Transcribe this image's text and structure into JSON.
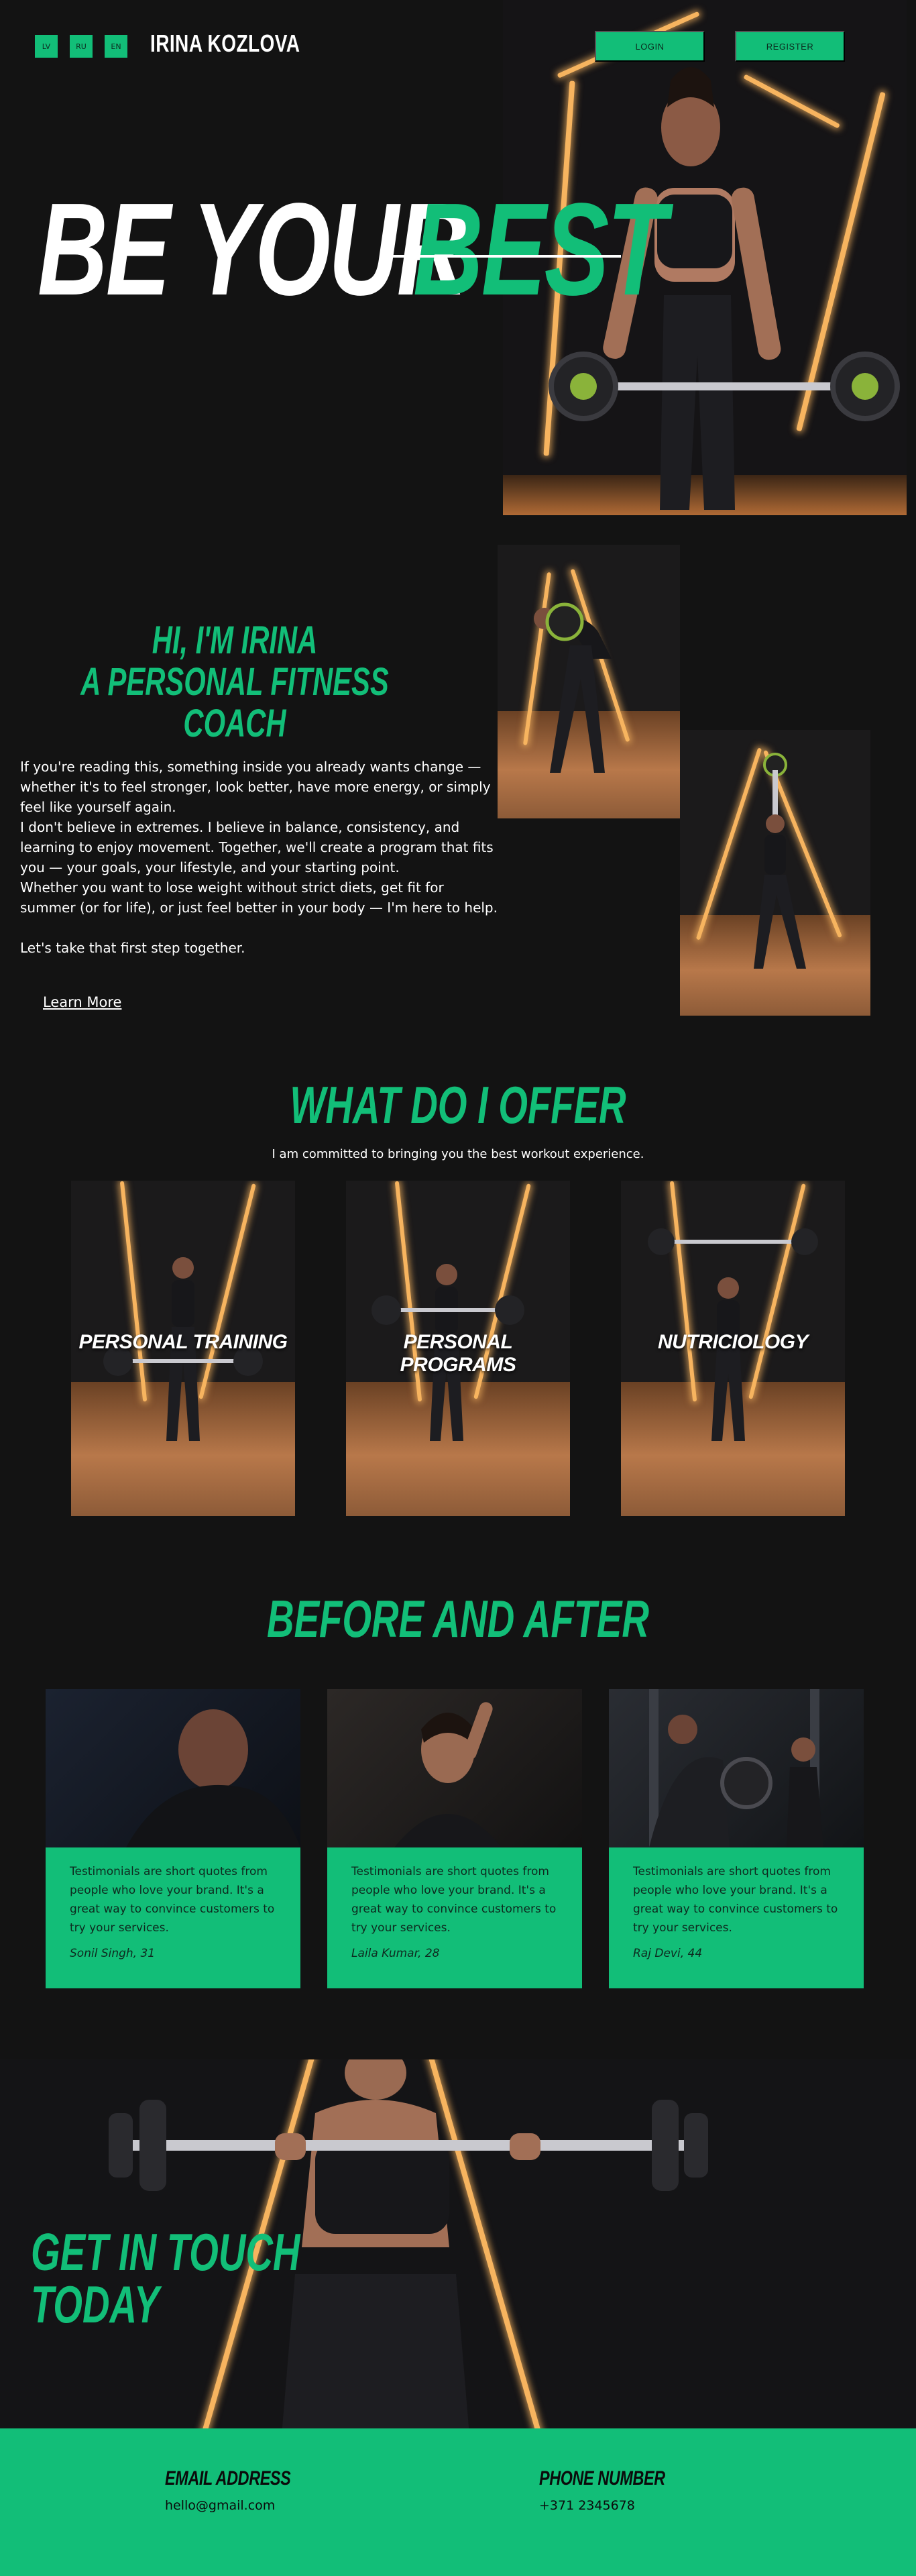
{
  "header": {
    "languages": [
      "LV",
      "RU",
      "EN"
    ],
    "brand": "IRINA KOZLOVA",
    "login_label": "LOGIN",
    "register_label": "REGISTER"
  },
  "hero": {
    "title_white": "BE YOUR",
    "title_green": "BEST"
  },
  "about": {
    "heading_line1": "HI, I'M IRINA",
    "heading_line2": "A PERSONAL FITNESS COACH",
    "paragraphs": [
      "If you're reading this, something inside you already wants change — whether it's to feel stronger, look better, have more energy, or simply feel like yourself again.",
      "I don't believe in extremes. I believe in balance, consistency, and learning to enjoy movement. Together, we'll create a program that fits you — your goals, your lifestyle, and your starting point.",
      "Whether you want to lose weight without strict diets, get fit for summer (or for life), or just feel better in your body — I'm here to help.",
      "Let's take that first step together."
    ],
    "learn_more": "Learn More"
  },
  "offer": {
    "heading": "WHAT DO I OFFER",
    "subheading": "I am committed to bringing you the best workout experience.",
    "cards": [
      {
        "title": "PERSONAL TRAINING"
      },
      {
        "title": "PERSONAL PROGRAMS"
      },
      {
        "title": "NUTRICIOLOGY"
      }
    ]
  },
  "before_after": {
    "heading": "BEFORE AND AFTER",
    "testimonials": [
      {
        "text": "Testimonials are short quotes from people who love your brand. It's a great way to convince customers to try your services.",
        "author": "Sonil Singh, 31"
      },
      {
        "text": "Testimonials are short quotes from people who love your brand. It's a great way to convince customers to try your services.",
        "author": "Laila Kumar, 28"
      },
      {
        "text": "Testimonials are short quotes from people who love your brand. It's a great way to convince customers to try your services.",
        "author": "Raj Devi, 44"
      }
    ]
  },
  "contact": {
    "heading_line1": "GET IN TOUCH",
    "heading_line2": "TODAY",
    "email_label": "EMAIL ADDRESS",
    "email_value": "hello@gmail.com",
    "phone_label": "PHONE NUMBER",
    "phone_value": "+371 2345678"
  },
  "colors": {
    "accent": "#12be78",
    "background": "#131313",
    "neon": "#f7b45f"
  }
}
